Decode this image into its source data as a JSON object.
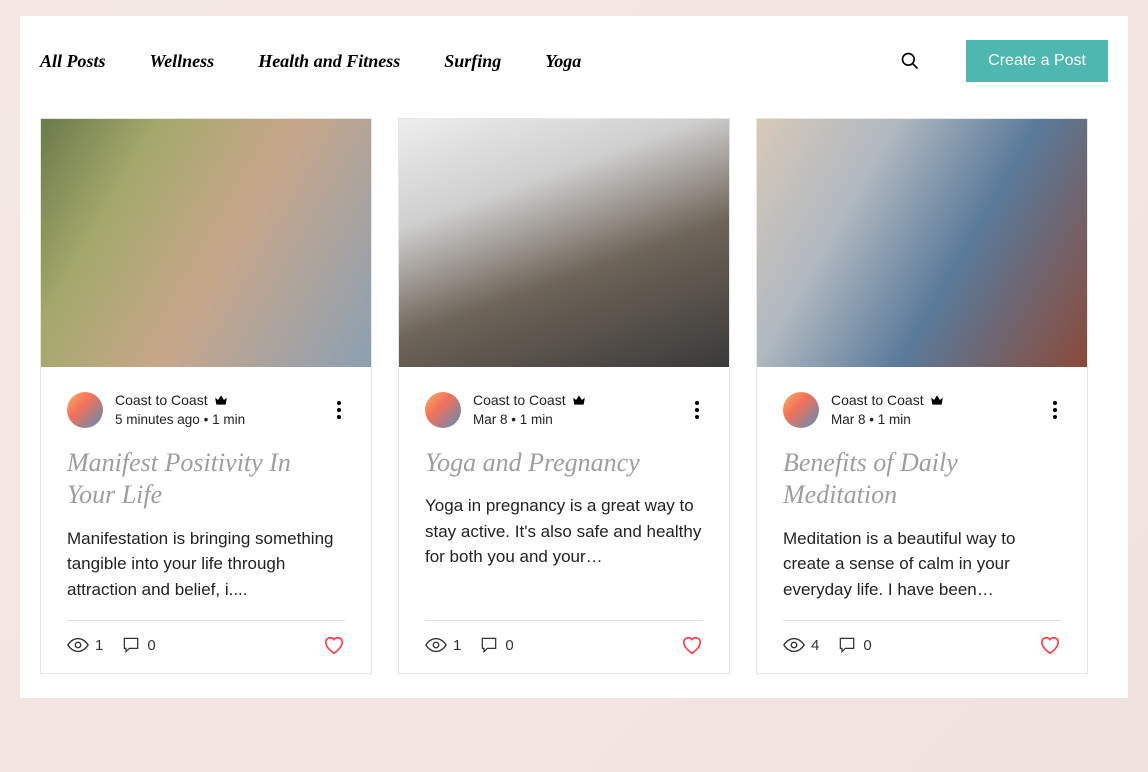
{
  "nav": {
    "items": [
      {
        "label": "All Posts"
      },
      {
        "label": "Wellness"
      },
      {
        "label": "Health and Fitness"
      },
      {
        "label": "Surfing"
      },
      {
        "label": "Yoga"
      }
    ]
  },
  "actions": {
    "create_label": "Create a Post"
  },
  "posts": [
    {
      "author": "Coast to Coast",
      "date": "5 minutes ago",
      "read_time": "1 min",
      "title": "Manifest Positivity In Your Life",
      "excerpt": "Manifestation is bringing something tangible into your life through attraction and belief, i....",
      "views": "1",
      "comments": "0"
    },
    {
      "author": "Coast to Coast",
      "date": "Mar 8",
      "read_time": "1 min",
      "title": "Yoga and Pregnancy",
      "excerpt": "Yoga in pregnancy is a great way to stay active. It's also safe and healthy for both you and your…",
      "views": "1",
      "comments": "0"
    },
    {
      "author": "Coast to Coast",
      "date": "Mar 8",
      "read_time": "1 min",
      "title": "Benefits of Daily Meditation",
      "excerpt": "Meditation is a beautiful way to create a sense of calm in your everyday life. I have been…",
      "views": "4",
      "comments": "0"
    }
  ],
  "meta_separator": "•"
}
